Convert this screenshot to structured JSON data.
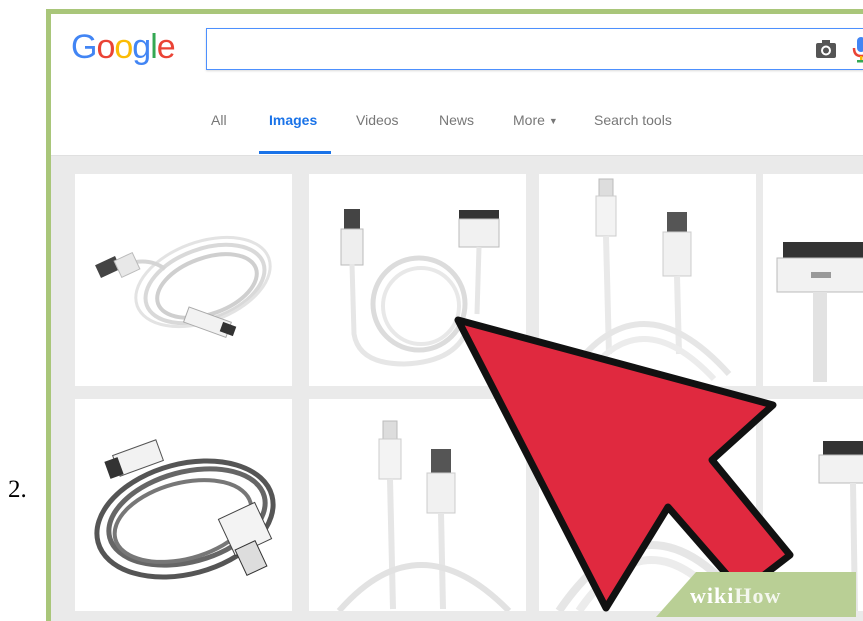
{
  "step": {
    "label": "2."
  },
  "logo": {
    "letters": [
      "G",
      "o",
      "o",
      "g",
      "l",
      "e"
    ],
    "colors": [
      "#4285f4",
      "#ea4335",
      "#fbbc05",
      "#4285f4",
      "#34a853",
      "#ea4335"
    ]
  },
  "search": {
    "value": "",
    "camera_icon": "camera-icon",
    "mic_icon": "microphone-icon"
  },
  "tabs": [
    {
      "label": "All",
      "active": false
    },
    {
      "label": "Images",
      "active": true
    },
    {
      "label": "Videos",
      "active": false
    },
    {
      "label": "News",
      "active": false
    },
    {
      "label": "More",
      "active": false
    },
    {
      "label": "Search tools",
      "active": false
    }
  ],
  "colors": {
    "frame_border": "#a9c67a",
    "tab_active": "#1a73e8",
    "arrow_fill": "#e0293f",
    "arrow_stroke": "#111111"
  },
  "watermark": {
    "wiki": "wiki",
    "how": "How"
  }
}
